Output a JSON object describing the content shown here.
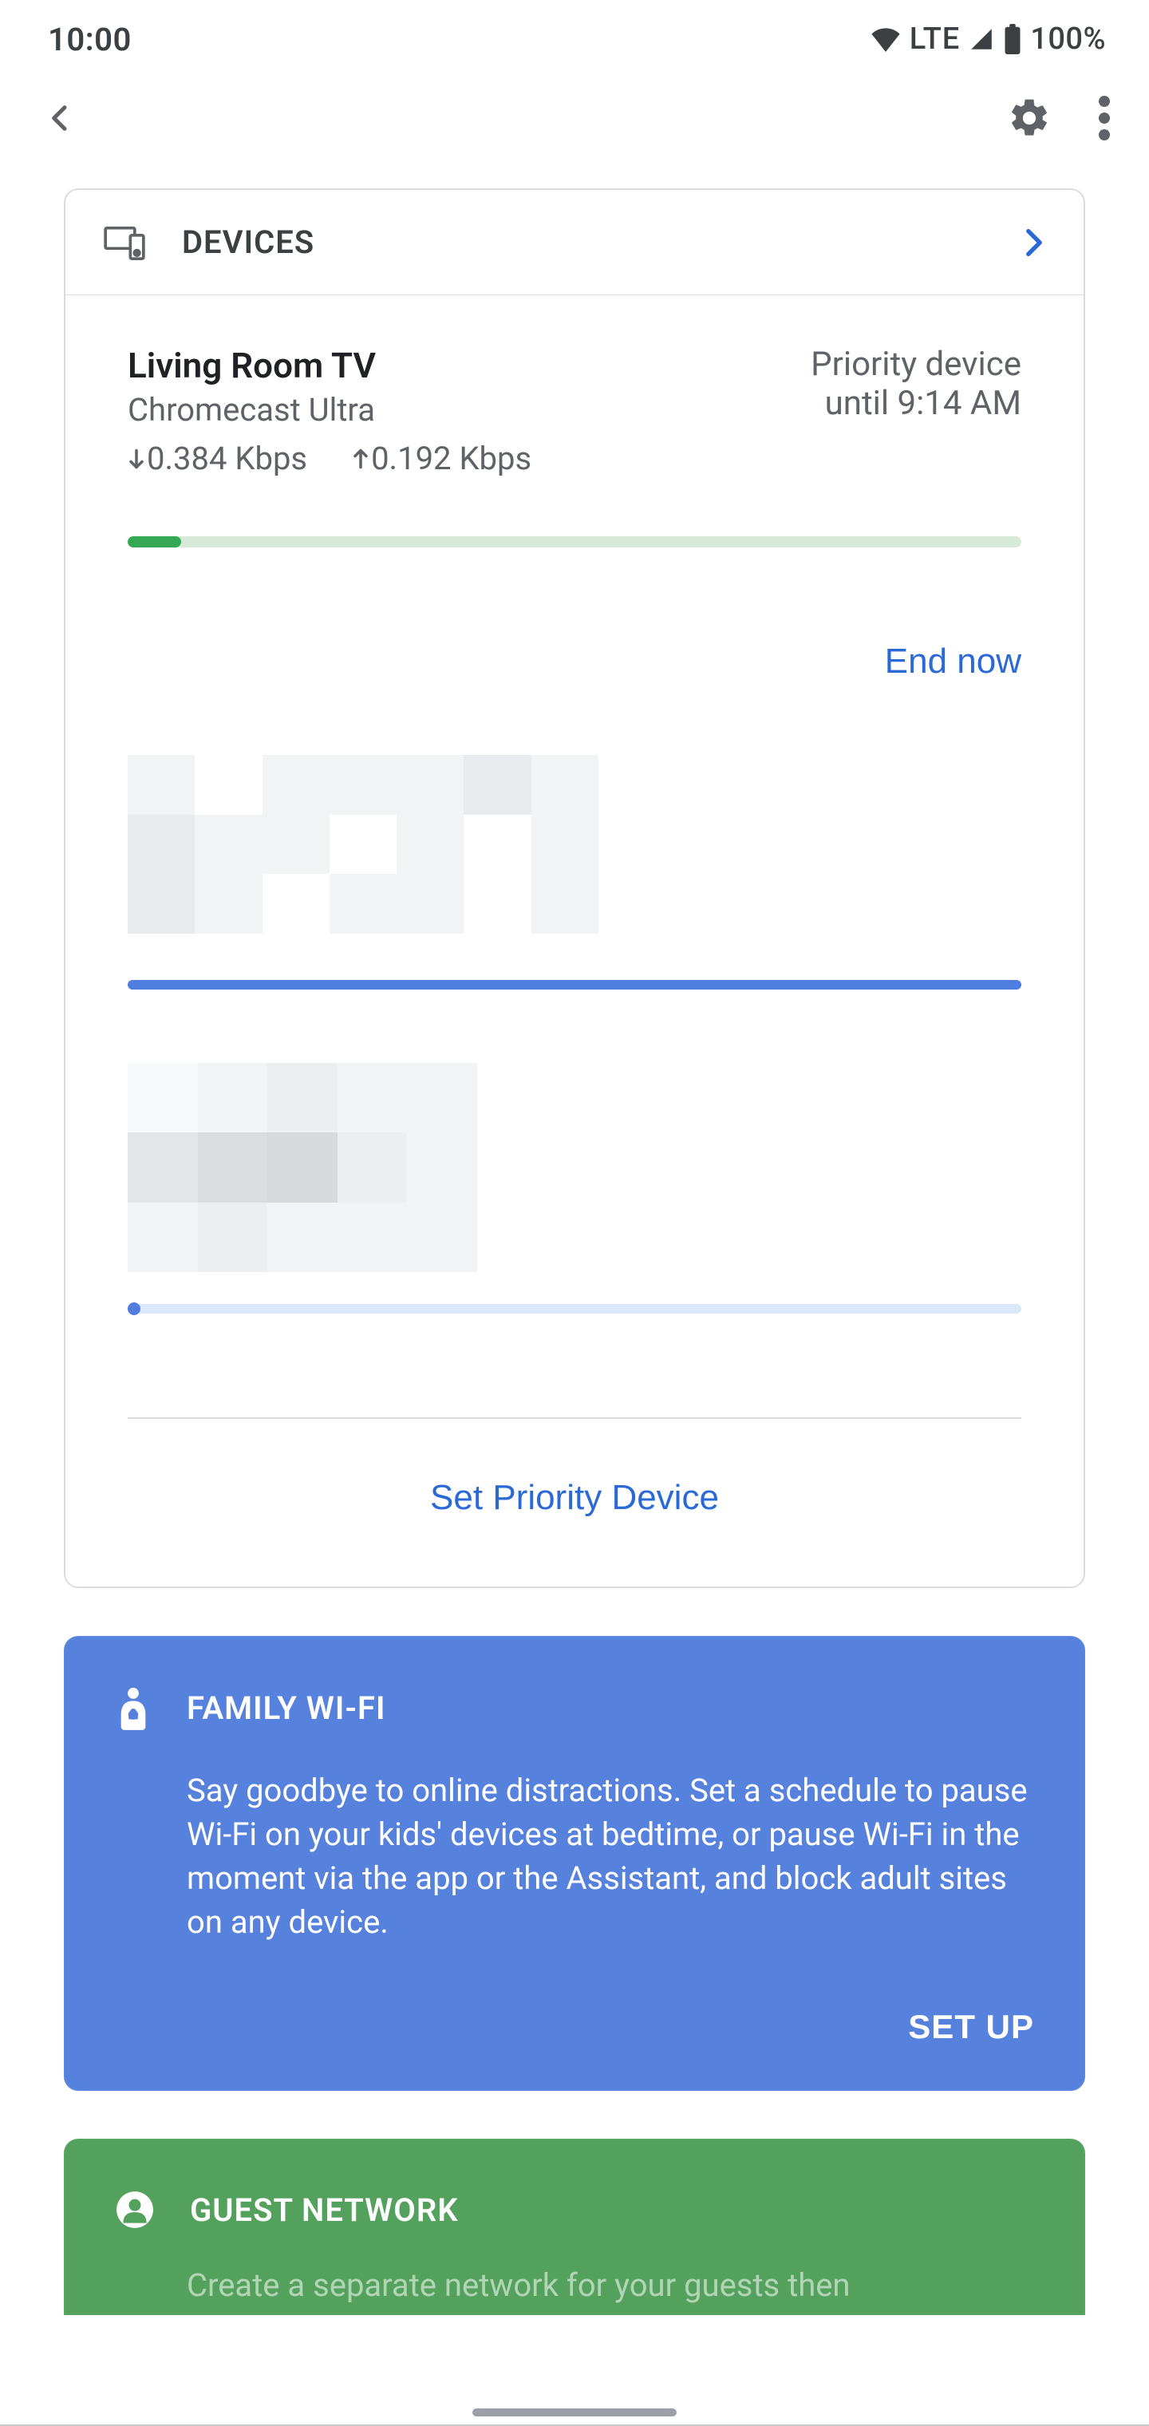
{
  "status_bar": {
    "time": "10:00",
    "lte": "LTE",
    "battery": "100%"
  },
  "devices_card": {
    "title": "DEVICES",
    "device_name": "Living Room TV",
    "device_sub": "Chromecast Ultra",
    "down": "0.384 Kbps",
    "up": "0.192 Kbps",
    "priority_line1": "Priority device",
    "priority_line2": "until 9:14 AM",
    "end_now": "End now",
    "set_priority": "Set Priority Device"
  },
  "family_card": {
    "title": "FAMILY WI-FI",
    "body": "Say goodbye to online distractions. Set a schedule to pause Wi-Fi on your kids' devices at bedtime, or pause Wi-Fi in the moment via the app or the Assistant, and block adult sites on any device.",
    "action": "SET UP"
  },
  "guest_card": {
    "title": "GUEST NETWORK",
    "body_partial": "Create a separate network for your guests then"
  },
  "colors": {
    "link": "#2a69d6",
    "green": "#34a853",
    "promo_blue": "#5681dc",
    "promo_green": "#53a15c"
  }
}
